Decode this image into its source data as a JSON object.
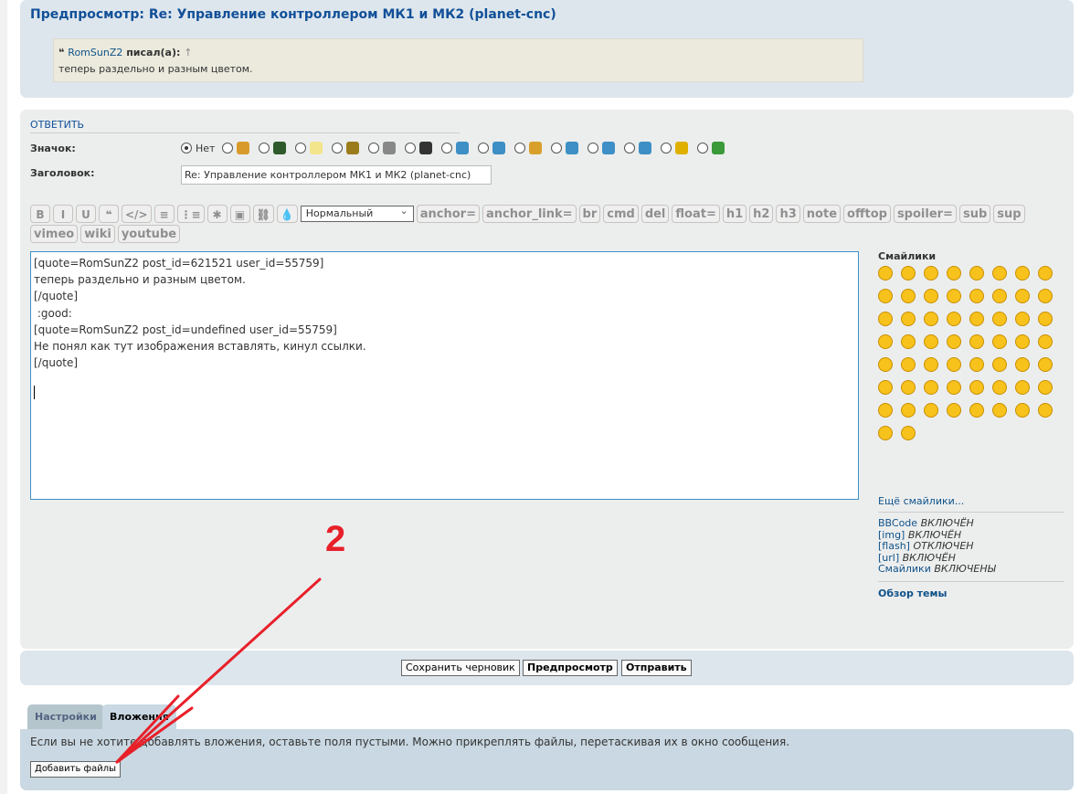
{
  "preview": {
    "title": "Предпросмотр: Re: Управление контроллером МК1 и МК2 (planet-cnc)",
    "quote_author": "RomSunZ2",
    "quote_wrote": "писал(а):",
    "quote_arrow": "↑",
    "quote_text": "теперь раздельно и разным цветом."
  },
  "reply": {
    "heading": "ОТВЕТИТЬ",
    "icon_label": "Значок:",
    "subject_label": "Заголовок:",
    "subject_value": "Re: Управление контроллером МК1 и МК2 (planet-cnc)",
    "icons": [
      {
        "name": "none",
        "label": "Нет",
        "selected": true
      },
      {
        "name": "beer"
      },
      {
        "name": "chip"
      },
      {
        "name": "bulb"
      },
      {
        "name": "pliers"
      },
      {
        "name": "wrench"
      },
      {
        "name": "motor"
      },
      {
        "name": "star"
      },
      {
        "name": "radiation"
      },
      {
        "name": "gear-sun"
      },
      {
        "name": "question"
      },
      {
        "name": "warning"
      },
      {
        "name": "info"
      },
      {
        "name": "eye-smile"
      },
      {
        "name": "green-smile"
      }
    ],
    "icon_colors": [
      "#d89b2b",
      "#2f5b2c",
      "#f2e58c",
      "#9a7c1d",
      "#888888",
      "#333333",
      "#3d8fc5",
      "#3d8fc5",
      "#d8a02b",
      "#3d8fc5",
      "#3d8fc5",
      "#3d8fc5",
      "#e0b000",
      "#3a9a3a"
    ]
  },
  "toolbar": {
    "icon_buttons": [
      "B",
      "I",
      "U",
      "❝",
      "</>",
      "≡",
      "⋮≡",
      "✱",
      "▣",
      "⛓",
      "💧"
    ],
    "font_size": "Нормальный",
    "tags": [
      "anchor=",
      "anchor_link=",
      "br",
      "cmd",
      "del",
      "float=",
      "h1",
      "h2",
      "h3",
      "note",
      "offtop",
      "spoiler=",
      "sub",
      "sup",
      "vimeo",
      "wiki",
      "youtube"
    ]
  },
  "message": {
    "lines": [
      "[quote=RomSunZ2 post_id=621521 user_id=55759]",
      "теперь раздельно и разным цветом.",
      "[/quote]",
      " :good:",
      "[quote=RomSunZ2 post_id=undefined user_id=55759]",
      "Не понял как тут изображения вставлять, кинул ссылки.",
      "[/quote]",
      ""
    ]
  },
  "smilies": {
    "title": "Смайлики",
    "count": 58,
    "more": "Ещё смайлики...",
    "options": [
      {
        "k": "BBCode",
        "v": "ВКЛЮЧЁН"
      },
      {
        "k": "[img]",
        "v": "ВКЛЮЧЁН"
      },
      {
        "k": "[flash]",
        "v": "ОТКЛЮЧЕН"
      },
      {
        "k": "[url]",
        "v": "ВКЛЮЧЁН"
      },
      {
        "k": "Смайлики",
        "v": "ВКЛЮЧЕНЫ"
      }
    ],
    "topic_review": "Обзор темы"
  },
  "buttons": {
    "save_draft": "Сохранить черновик",
    "preview": "Предпросмотр",
    "submit": "Отправить"
  },
  "tabs": {
    "settings": "Настройки",
    "attachments": "Вложения"
  },
  "attachments": {
    "hint": "Если вы не хотите добавлять вложения, оставьте поля пустыми. Можно прикреплять файлы, перетаскивая их в окно сообщения.",
    "add_files": "Добавить файлы"
  },
  "annotation": {
    "label": "2",
    "color": "#e8202a"
  }
}
